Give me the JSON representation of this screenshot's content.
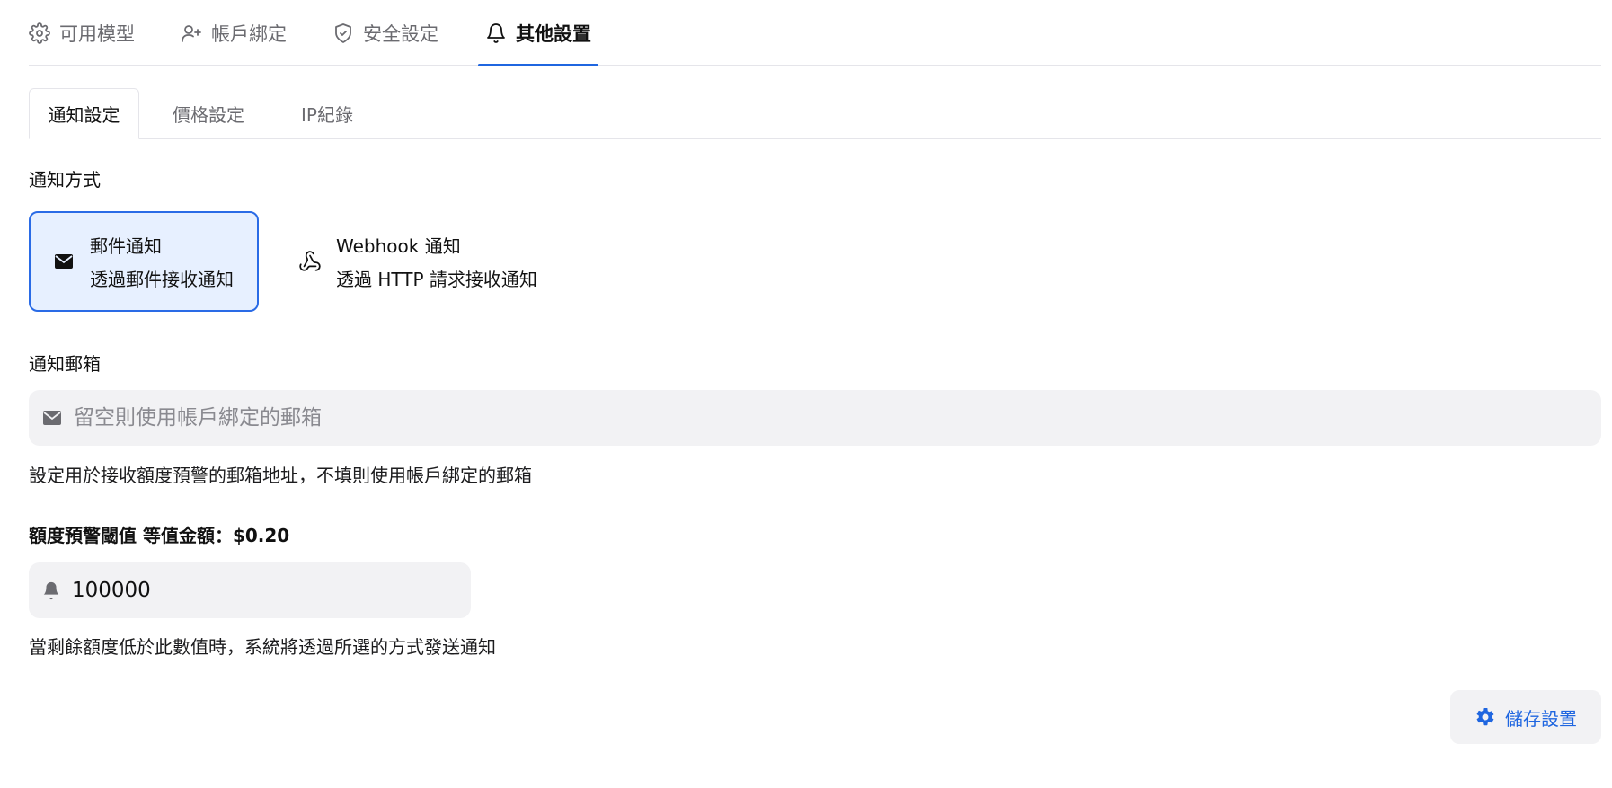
{
  "top_tabs": [
    {
      "label": "可用模型",
      "icon": "gear-icon"
    },
    {
      "label": "帳戶綁定",
      "icon": "user-plus-icon"
    },
    {
      "label": "安全設定",
      "icon": "shield-check-icon"
    },
    {
      "label": "其他設置",
      "icon": "bell-icon",
      "active": true
    }
  ],
  "sub_tabs": [
    {
      "label": "通知設定",
      "active": true
    },
    {
      "label": "價格設定"
    },
    {
      "label": "IP紀錄"
    }
  ],
  "notify_method": {
    "label": "通知方式",
    "options": [
      {
        "title": "郵件通知",
        "desc": "透過郵件接收通知",
        "icon": "mail-icon",
        "selected": true
      },
      {
        "title": "Webhook 通知",
        "desc": "透過 HTTP 請求接收通知",
        "icon": "webhook-icon"
      }
    ]
  },
  "notify_email": {
    "label": "通知郵箱",
    "value": "",
    "placeholder": "留空則使用帳戶綁定的郵箱",
    "help": "設定用於接收額度預警的郵箱地址，不填則使用帳戶綁定的郵箱"
  },
  "quota_threshold": {
    "label": "額度預警閾值 等值金額：$0.20",
    "value": "100000",
    "help": "當剩餘額度低於此數值時，系統將透過所選的方式發送通知"
  },
  "save_button": {
    "label": "儲存設置",
    "icon": "gear-icon"
  },
  "colors": {
    "accent": "#1f66e0",
    "selected_bg": "#e7f0ff",
    "input_bg": "#f2f2f4"
  }
}
